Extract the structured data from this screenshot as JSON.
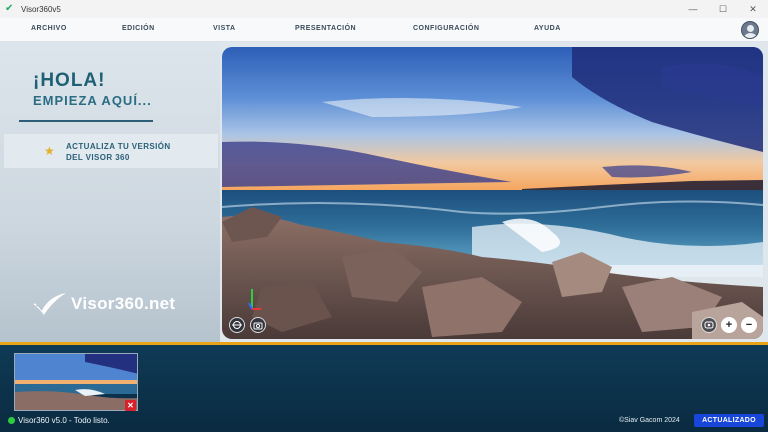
{
  "window": {
    "title": "Visor360v5",
    "minimize_glyph": "—",
    "maximize_glyph": "☐",
    "close_glyph": "✕"
  },
  "menu": {
    "items": [
      {
        "label": "ARCHIVO"
      },
      {
        "label": "EDICIÓN"
      },
      {
        "label": "VISTA"
      },
      {
        "label": "PRESENTACIÓN"
      },
      {
        "label": "CONFIGURACIÓN"
      },
      {
        "label": "AYUDA"
      }
    ]
  },
  "left_panel": {
    "greeting": "¡HOLA!",
    "subtitle": "EMPIEZA AQUÍ...",
    "upgrade_line1": "ACTUALIZA TU VERSIÓN",
    "upgrade_line2": "DEL VISOR 360",
    "logo_text": "Visor360.net"
  },
  "viewer": {
    "icons": [
      "gyro-icon",
      "camera-icon",
      "vr-icon",
      "zoom-in-icon",
      "zoom-out-icon"
    ],
    "zoom_in_glyph": "+",
    "zoom_out_glyph": "−"
  },
  "bottom": {
    "thumbnail_close_glyph": "✕",
    "status_text": "Visor360 v5.0 - Todo listo.",
    "copyright": "©Siav Gacom 2024",
    "badge": "ACTUALIZADO"
  },
  "colors": {
    "accent_orange": "#e8a317",
    "bottom_bg": "#0f3a56",
    "badge_blue": "#1746d9",
    "title_teal": "#1f6075"
  }
}
